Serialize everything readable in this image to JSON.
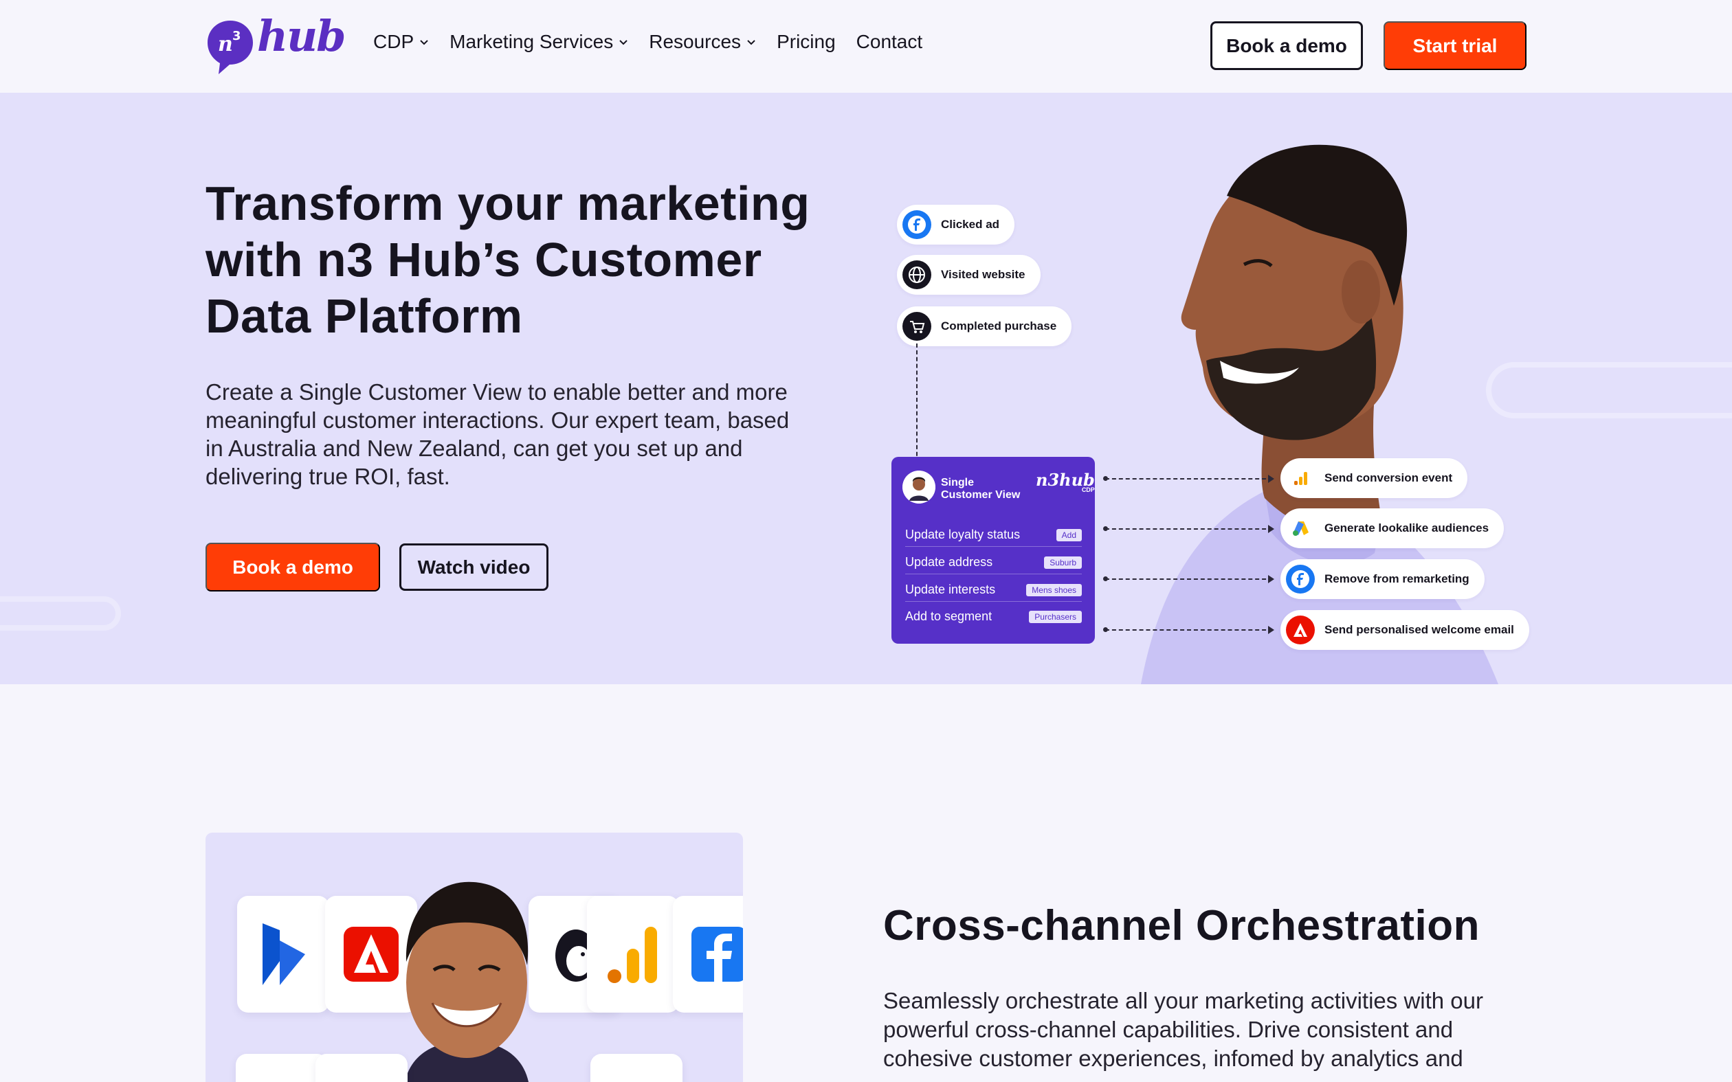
{
  "brand": {
    "logo_mark": "n3",
    "logo_text": "hub",
    "accent": "#ff3d06",
    "purple": "#5630c8"
  },
  "nav": {
    "items": [
      {
        "label": "CDP",
        "dropdown": true
      },
      {
        "label": "Marketing Services",
        "dropdown": true
      },
      {
        "label": "Resources",
        "dropdown": true
      },
      {
        "label": "Pricing",
        "dropdown": false
      },
      {
        "label": "Contact",
        "dropdown": false
      }
    ],
    "book_demo": "Book a demo",
    "start_trial": "Start trial"
  },
  "hero": {
    "title": "Transform your marketing with n3 Hub’s Customer Data Platform",
    "description": "Create a Single Customer View to enable better and more meaningful customer interactions. Our expert team, based in Australia and New Zealand, can get you set up and delivering true ROI, fast.",
    "book_demo": "Book a demo",
    "watch_video": "Watch video",
    "events": [
      {
        "label": "Clicked ad",
        "icon": "facebook-icon"
      },
      {
        "label": "Visited website",
        "icon": "globe-icon"
      },
      {
        "label": "Completed purchase",
        "icon": "cart-icon"
      }
    ],
    "scv": {
      "title_line1": "Single",
      "title_line2": "Customer View",
      "logo": "n3hub",
      "logo_sub": "CDP",
      "rows": [
        {
          "label": "Update loyalty status",
          "tag": "Add"
        },
        {
          "label": "Update address",
          "tag": "Suburb"
        },
        {
          "label": "Update interests",
          "tag": "Mens shoes"
        },
        {
          "label": "Add to segment",
          "tag": "Purchasers"
        }
      ]
    },
    "actions": [
      {
        "label": "Send conversion event",
        "icon": "analytics-icon"
      },
      {
        "label": "Generate lookalike audiences",
        "icon": "google-ads-icon"
      },
      {
        "label": "Remove from remarketing",
        "icon": "facebook-icon"
      },
      {
        "label": "Send personalised welcome email",
        "icon": "adobe-icon"
      }
    ]
  },
  "section2": {
    "title": "Cross-channel Orchestration",
    "description": "Seamlessly orchestrate all your marketing activities with our powerful cross-channel capabilities. Drive consistent and cohesive customer experiences, infomed by analytics and"
  }
}
